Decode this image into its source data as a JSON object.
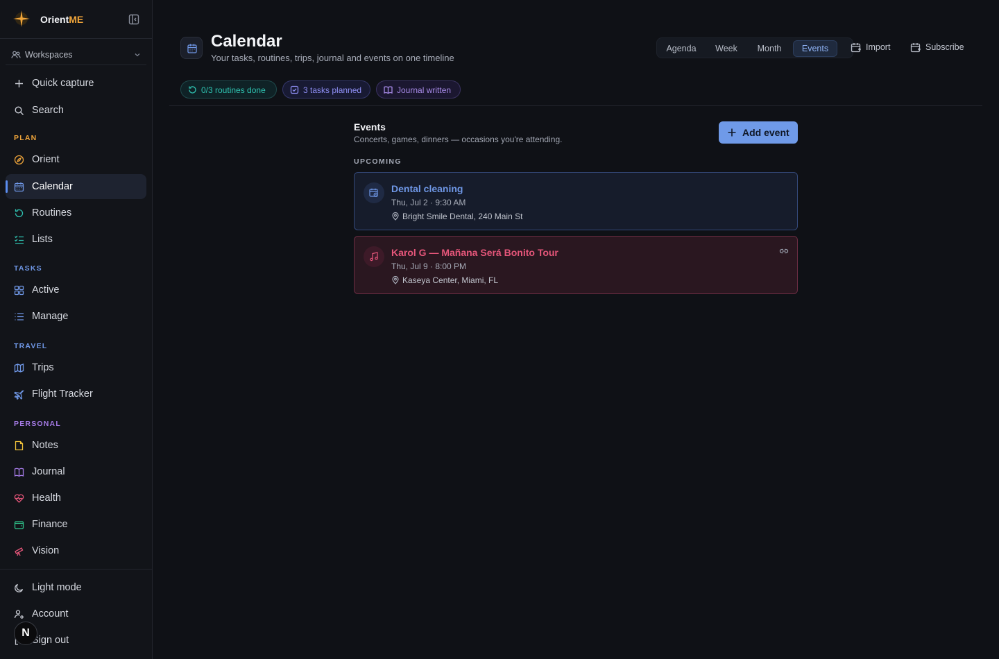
{
  "brand": {
    "name_part1": "Orient",
    "name_part2": "ME"
  },
  "workspaces": {
    "label": "Workspaces"
  },
  "quick_actions": [
    {
      "label": "Quick capture",
      "icon": "plus-icon"
    },
    {
      "label": "Search",
      "icon": "search-icon"
    }
  ],
  "sections": {
    "plan": {
      "title": "PLAN",
      "color": "#f0a53a",
      "items": [
        {
          "label": "Orient",
          "icon": "compass-icon",
          "color": "#f0a53a"
        },
        {
          "label": "Calendar",
          "icon": "calendar-icon",
          "color": "#6f97e6",
          "active": true
        },
        {
          "label": "Routines",
          "icon": "refresh-icon",
          "color": "#2fc4b2"
        },
        {
          "label": "Lists",
          "icon": "checklist-icon",
          "color": "#2fc4b2"
        }
      ]
    },
    "tasks": {
      "title": "TASKS",
      "color": "#6f97e6",
      "items": [
        {
          "label": "Active",
          "icon": "grid-icon",
          "color": "#6f97e6"
        },
        {
          "label": "Manage",
          "icon": "list-icon",
          "color": "#6f97e6"
        }
      ]
    },
    "travel": {
      "title": "TRAVEL",
      "color": "#6f97e6",
      "items": [
        {
          "label": "Trips",
          "icon": "map-icon",
          "color": "#6f97e6"
        },
        {
          "label": "Flight Tracker",
          "icon": "plane-icon",
          "color": "#6f97e6"
        }
      ]
    },
    "personal": {
      "title": "PERSONAL",
      "color": "#a57be6",
      "items": [
        {
          "label": "Notes",
          "icon": "note-icon",
          "color": "#f0c23a"
        },
        {
          "label": "Journal",
          "icon": "book-icon",
          "color": "#a57be6"
        },
        {
          "label": "Health",
          "icon": "heart-pulse-icon",
          "color": "#e6567a"
        },
        {
          "label": "Finance",
          "icon": "wallet-icon",
          "color": "#2fc48a"
        },
        {
          "label": "Vision",
          "icon": "telescope-icon",
          "color": "#e6567a"
        }
      ]
    }
  },
  "bottom": [
    {
      "label": "Light mode",
      "icon": "moon-icon"
    },
    {
      "label": "Account",
      "icon": "user-settings-icon"
    },
    {
      "label": "Sign out",
      "icon": "logout-icon"
    }
  ],
  "avatar": {
    "letter": "N"
  },
  "header": {
    "title": "Calendar",
    "subtitle": "Your tasks, routines, trips, journal and events on one timeline",
    "views": [
      "Agenda",
      "Week",
      "Month",
      "Events"
    ],
    "active_view": "Events",
    "import_label": "Import",
    "subscribe_label": "Subscribe"
  },
  "chips": [
    {
      "label": "0/3 routines done",
      "icon": "refresh-icon",
      "color": "#2fc4b2",
      "bg": "#0f2226",
      "border": "#1f4a4c"
    },
    {
      "label": "3 tasks planned",
      "icon": "checkbox-icon",
      "color": "#8f8ff5",
      "bg": "#181a33",
      "border": "#34376b"
    },
    {
      "label": "Journal written",
      "icon": "book-icon",
      "color": "#a88be8",
      "bg": "#1b1730",
      "border": "#3b3362"
    }
  ],
  "events": {
    "title": "Events",
    "subtitle": "Concerts, games, dinners — occasions you're attending.",
    "add_label": "Add event",
    "upcoming_label": "UPCOMING",
    "items": [
      {
        "title": "Dental cleaning",
        "datetime": "Thu, Jul 2 · 9:30 AM",
        "location": "Bright Smile Dental, 240 Main St",
        "icon": "calendar-clock-icon",
        "color": "#6f97e6"
      },
      {
        "title": "Karol G — Mañana Será Bonito Tour",
        "datetime": "Thu, Jul 9 · 8:00 PM",
        "location": "Kaseya Center, Miami, FL",
        "icon": "music-icon",
        "color": "#e6567a",
        "has_link": true
      }
    ]
  }
}
